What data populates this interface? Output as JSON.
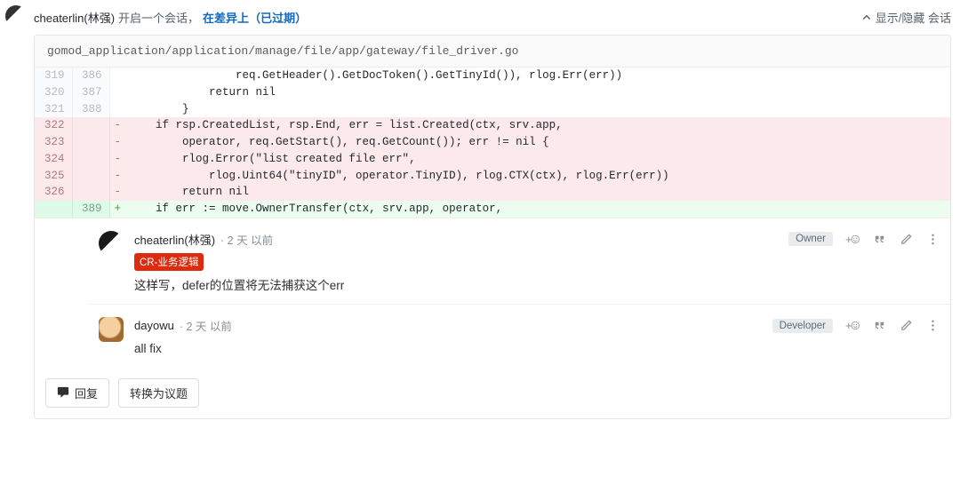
{
  "header": {
    "author": "cheaterlin(林强)",
    "action_text": "开启一个会话，",
    "status_prefix": "在差异上",
    "status_suffix": "（已过期）",
    "toggle_label": "显示/隐藏 会话"
  },
  "file_path": "gomod_application/application/manage/file/app/gateway/file_driver.go",
  "diff": [
    {
      "old": "319",
      "new": "386",
      "sign": "",
      "type": "ctx",
      "code": "                req.GetHeader().GetDocToken().GetTinyId()), rlog.Err(err))"
    },
    {
      "old": "320",
      "new": "387",
      "sign": "",
      "type": "ctx",
      "code": "            <kw>return</kw> <lit>nil</lit>"
    },
    {
      "old": "321",
      "new": "388",
      "sign": "",
      "type": "ctx",
      "code": "        }"
    },
    {
      "old": "322",
      "new": "",
      "sign": "-",
      "type": "removed",
      "code": "    <kw>if</kw> rsp.CreatedList, rsp.End, err = list.Created(ctx, srv.app,"
    },
    {
      "old": "323",
      "new": "",
      "sign": "-",
      "type": "removed",
      "code": "        operator, req.GetStart(), req.GetCount()); err != <lit>nil</lit> {"
    },
    {
      "old": "324",
      "new": "",
      "sign": "-",
      "type": "removed",
      "code": "        rlog.Error(<str>\"list created file err\"</str>,"
    },
    {
      "old": "325",
      "new": "",
      "sign": "-",
      "type": "removed",
      "code": "            rlog.Uint64(<str>\"tinyID\"</str>, operator.TinyID), rlog.CTX(ctx), rlog.Err(err))"
    },
    {
      "old": "326",
      "new": "",
      "sign": "-",
      "type": "removed",
      "code": "        <kw>return</kw> <lit>nil</lit>"
    },
    {
      "old": "",
      "new": "389",
      "sign": "+",
      "type": "added",
      "code": "    <kw>if</kw> err := move.OwnerTransfer(ctx, srv.app, operator,"
    }
  ],
  "comment_count": "2",
  "comments": [
    {
      "avatar": "user1",
      "author": "cheaterlin(林强)",
      "time": "· 2 天 以前",
      "role": "Owner",
      "tag": "CR-业务逻辑",
      "body": "这样写，defer的位置将无法捕获这个err"
    },
    {
      "avatar": "user2",
      "author": "dayowu",
      "time": "· 2 天 以前",
      "role": "Developer",
      "tag": null,
      "body": "all fix"
    }
  ],
  "footer": {
    "reply": "回复",
    "to_issue": "转换为议题"
  }
}
